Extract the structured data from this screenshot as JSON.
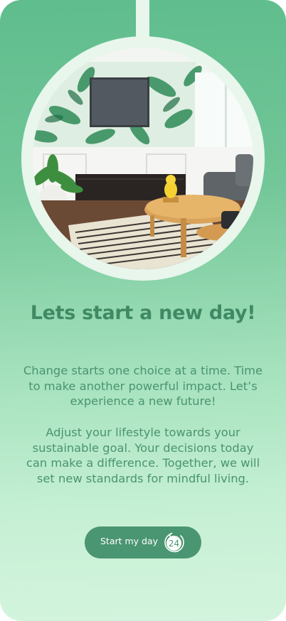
{
  "headline": "Lets start a new day!",
  "paragraphs": [
    "Change starts one choice at a time. Time to make another powerful impact. Let’s experience a new future!",
    "Adjust your lifestyle towards your sustainable goal. Your decisions today can make a difference. Together, we will set new standards for mindful living."
  ],
  "cta": {
    "label": "Start my day",
    "icon": "clock-24-icon",
    "icon_text": "24"
  },
  "colors": {
    "accent": "#4a9572",
    "title": "#3f8a64",
    "background_top": "#5fbd8d",
    "background_bottom": "#d3f4de"
  }
}
